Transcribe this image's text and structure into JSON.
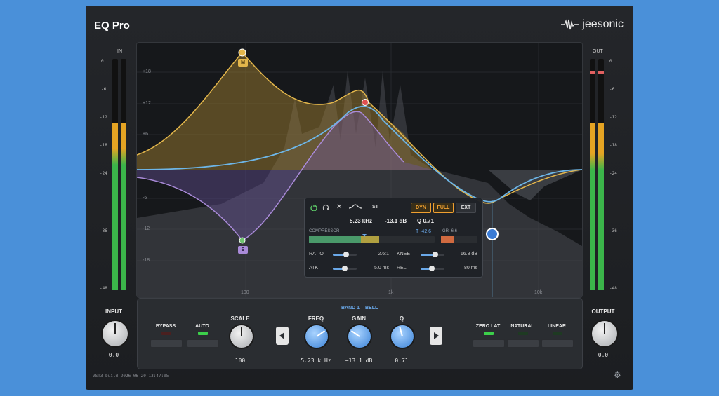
{
  "app": {
    "title": "EQ Pro",
    "brand": "jeesonic"
  },
  "meters": {
    "in_label": "IN",
    "out_label": "OUT",
    "scale": [
      "0",
      "-6",
      "-12",
      "-18",
      "-24",
      "-36",
      "-48"
    ],
    "in_level": 0.72,
    "out_level": 0.72
  },
  "graph": {
    "db_labels": [
      "+18",
      "+12",
      "+6",
      "-6",
      "-12",
      "-18"
    ],
    "freq_labels": [
      "100",
      "1k",
      "10k"
    ],
    "node_low": "M",
    "node_mid": "S"
  },
  "popup": {
    "st_label": "ST",
    "dyn_label": "DYN",
    "full_label": "FULL",
    "ext_label": "EXT",
    "freq": "5.23 kHz",
    "gain": "-13.1 dB",
    "q": "Q 0.71",
    "compressor_label": "COMPRESSOR",
    "threshold": "T -42.6",
    "gr": "GR -6.6",
    "ratio_label": "RATIO",
    "ratio_value": "2.6:1",
    "knee_label": "KNEE",
    "knee_value": "16.8 dB",
    "atk_label": "ATK",
    "atk_value": "5.0 ms",
    "rel_label": "REL",
    "rel_value": "80 ms",
    "ratio_level": 0.55,
    "knee_level": 0.6,
    "atk_level": 0.5,
    "rel_level": 0.45
  },
  "input": {
    "label": "INPUT",
    "value": "0.0"
  },
  "output": {
    "label": "OUTPUT",
    "value": "0.0"
  },
  "band": {
    "band_label": "BAND 1",
    "type_label": "BELL"
  },
  "toggles": {
    "bypass": "BYPASS",
    "auto": "AUTO",
    "zero_lat": "ZERO LAT",
    "natural": "NATURAL",
    "linear": "LINEAR"
  },
  "scale_knob": {
    "label": "SCALE",
    "value": "100"
  },
  "freq_knob": {
    "label": "FREQ",
    "value": "5.23 k Hz"
  },
  "gain_knob": {
    "label": "GAIN",
    "value": "−13.1 dB"
  },
  "q_knob": {
    "label": "Q",
    "value": "0.71"
  },
  "footer": {
    "build": "VST3  build 2026-06-20 13:47:05"
  },
  "colors": {
    "accent": "#6aa8e8",
    "yellow": "#e3b64b",
    "purple": "#a98ad8",
    "orange": "#f0a030"
  }
}
